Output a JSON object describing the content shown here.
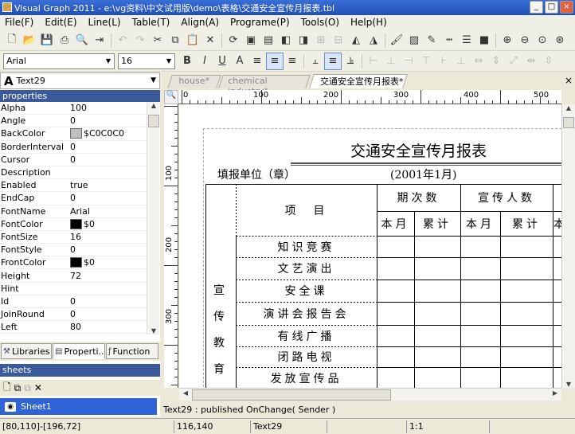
{
  "window": {
    "title": "Visual Graph 2011 - e:\\vg资料\\中文试用版\\demo\\表格\\交通安全宣传月报表.tbl"
  },
  "menu": [
    "File(F)",
    "Edit(E)",
    "Line(L)",
    "Table(T)",
    "Align(A)",
    "Programe(P)",
    "Tools(O)",
    "Help(H)"
  ],
  "toolbar": {
    "font_name": "Arial",
    "font_size": "16"
  },
  "object_selector": {
    "icon_glyph": "A",
    "value": "Text29"
  },
  "properties_header": "properties",
  "properties": [
    {
      "name": "Alpha",
      "value": "100"
    },
    {
      "name": "Angle",
      "value": "0"
    },
    {
      "name": "BackColor",
      "value": "$C0C0C0",
      "color": "#c0c0c0"
    },
    {
      "name": "BorderInterval",
      "value": "0"
    },
    {
      "name": "Cursor",
      "value": "0"
    },
    {
      "name": "Description",
      "value": ""
    },
    {
      "name": "Enabled",
      "value": "true"
    },
    {
      "name": "EndCap",
      "value": "0"
    },
    {
      "name": "FontName",
      "value": "Arial"
    },
    {
      "name": "FontColor",
      "value": "$0",
      "color": "#000000"
    },
    {
      "name": "FontSize",
      "value": "16"
    },
    {
      "name": "FontStyle",
      "value": "0"
    },
    {
      "name": "FrontColor",
      "value": "$0",
      "color": "#000000"
    },
    {
      "name": "Height",
      "value": "72"
    },
    {
      "name": "Hint",
      "value": ""
    },
    {
      "name": "Id",
      "value": "0"
    },
    {
      "name": "JoinRound",
      "value": "0"
    },
    {
      "name": "Left",
      "value": "80"
    }
  ],
  "panel_tabs": [
    {
      "label": "Libraries",
      "icon": "wrench-icon"
    },
    {
      "label": "Properti..",
      "icon": "properties-icon"
    },
    {
      "label": "Function",
      "icon": "function-icon"
    }
  ],
  "sheets_header": "sheets",
  "sheets": [
    "Sheet1"
  ],
  "doc_tabs": [
    "house*",
    "chemical industry*",
    "交通安全宣传月报表*"
  ],
  "rulers": {
    "h_labels": [
      "0",
      "100",
      "200",
      "300",
      "400",
      "500"
    ],
    "v_labels": [
      "100",
      "200",
      "300"
    ]
  },
  "report": {
    "title": "交通安全宣传月报表",
    "fill_unit": "填报单位（章）",
    "period": "(2001年1月)",
    "col_item": "项　目",
    "col_times": "期次数",
    "col_people": "宣传人数",
    "sub_month": "本月",
    "sub_total": "累计",
    "sub_more": "本",
    "category": [
      "宣",
      "传",
      "教",
      "育"
    ],
    "rows": [
      "知识竞赛",
      "文艺演出",
      "安全课",
      "演讲会报告会",
      "有线广播",
      "闭路电视",
      "发放宣传品"
    ]
  },
  "event_text": "Text29 : published OnChange( Sender )",
  "status": [
    "[80,110]-[196,72]",
    "116,140",
    "Text29",
    "",
    "1:1",
    ""
  ]
}
